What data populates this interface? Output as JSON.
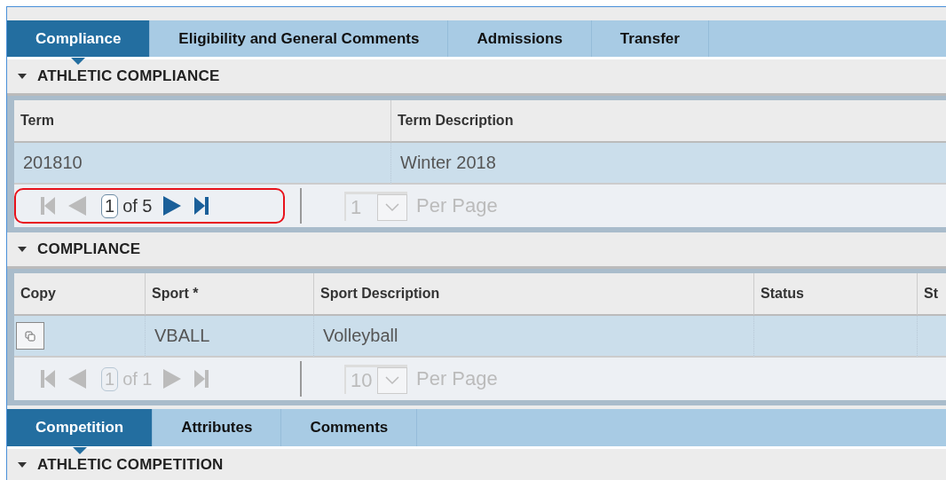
{
  "tabs": [
    {
      "label": "Compliance",
      "selected": true
    },
    {
      "label": "Eligibility and General Comments",
      "selected": false
    },
    {
      "label": "Admissions",
      "selected": false
    },
    {
      "label": "Transfer",
      "selected": false
    }
  ],
  "sections": [
    {
      "title": "ATHLETIC COMPLIANCE",
      "expanded": true,
      "columns": [
        "Term",
        "Term Description"
      ],
      "rows": [
        {
          "selected": true,
          "cells": [
            {
              "kind": "field",
              "text": "201810"
            },
            {
              "kind": "text",
              "text": "Winter 2018"
            }
          ]
        }
      ],
      "pager": {
        "highlighted": true,
        "disabled": false,
        "page": "1",
        "total": "of 5",
        "per_page": "1",
        "per_page_label": "Per Page",
        "buttons": [
          {
            "kind": "first",
            "disabled": true
          },
          {
            "kind": "prev",
            "disabled": true
          },
          {
            "kind": "next",
            "disabled": false
          },
          {
            "kind": "last",
            "disabled": false
          }
        ]
      }
    },
    {
      "title": "COMPLIANCE",
      "expanded": true,
      "columns": [
        "Copy",
        "Sport *",
        "Sport Description",
        "Status",
        "St"
      ],
      "rows": [
        {
          "selected": true,
          "cells": [
            {
              "kind": "copy"
            },
            {
              "kind": "text",
              "text": "VBALL"
            },
            {
              "kind": "text",
              "text": "Volleyball"
            },
            {
              "kind": "empty"
            },
            {
              "kind": "empty"
            }
          ]
        }
      ],
      "pager": {
        "disabled": true,
        "page": "1",
        "total": "of 1",
        "per_page": "10",
        "per_page_label": "Per Page",
        "buttons": [
          {
            "kind": "first",
            "disabled": true
          },
          {
            "kind": "prev",
            "disabled": true
          },
          {
            "kind": "next",
            "disabled": true
          },
          {
            "kind": "last",
            "disabled": true
          }
        ]
      }
    }
  ],
  "bottom_tabs": [
    {
      "label": "Competition",
      "selected": true
    },
    {
      "label": "Attributes",
      "selected": false
    },
    {
      "label": "Comments",
      "selected": false
    }
  ],
  "bottom_section": {
    "title": "ATHLETIC COMPETITION",
    "expanded": true
  }
}
